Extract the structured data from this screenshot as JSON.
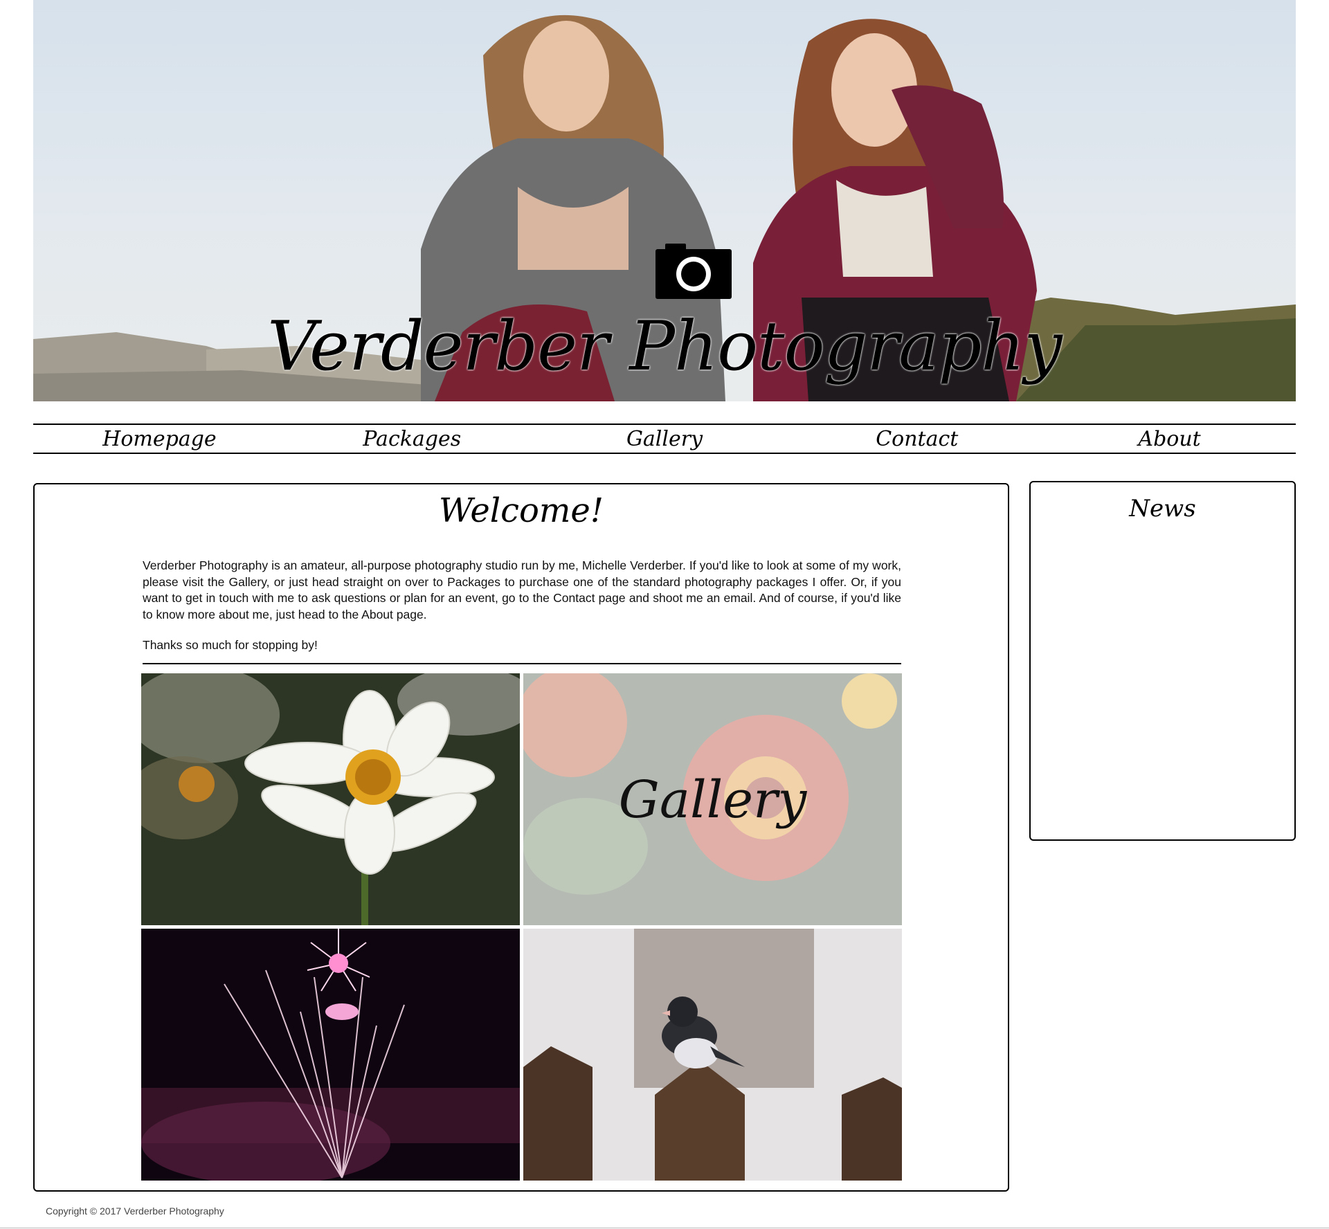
{
  "header": {
    "site_title": "Verderber Photography",
    "logo_icon": "camera-icon",
    "hero_image": "two-girls-on-mountain-photo"
  },
  "nav": {
    "items": [
      {
        "label": "Homepage"
      },
      {
        "label": "Packages"
      },
      {
        "label": "Gallery"
      },
      {
        "label": "Contact"
      },
      {
        "label": "About"
      }
    ]
  },
  "main": {
    "heading": "Welcome!",
    "intro": "Verderber Photography is an amateur, all-purpose photography studio run by me, Michelle Verderber. If you'd like to look at some of my work, please visit the Gallery, or just head straight on over to Packages to purchase one of the standard photography packages I offer. Or, if you want to get in touch with me to ask questions or plan for an event, go to the Contact page and shoot me an email. And of course, if you'd like to know more about me, just head to the About page.",
    "thanks": "Thanks so much for stopping by!",
    "gallery_tiles": [
      {
        "image": "white-daisy-photo"
      },
      {
        "image": "marigold-photo",
        "overlay_label": "Gallery"
      },
      {
        "image": "fireworks-photo"
      },
      {
        "image": "junco-bird-on-fence-photo"
      }
    ]
  },
  "sidebar": {
    "news_title": "News"
  },
  "footer": {
    "copyright": "Copyright © 2017 Verderber Photography"
  },
  "colors": {
    "border": "#000000",
    "background": "#ffffff",
    "footer_text": "#444444"
  }
}
